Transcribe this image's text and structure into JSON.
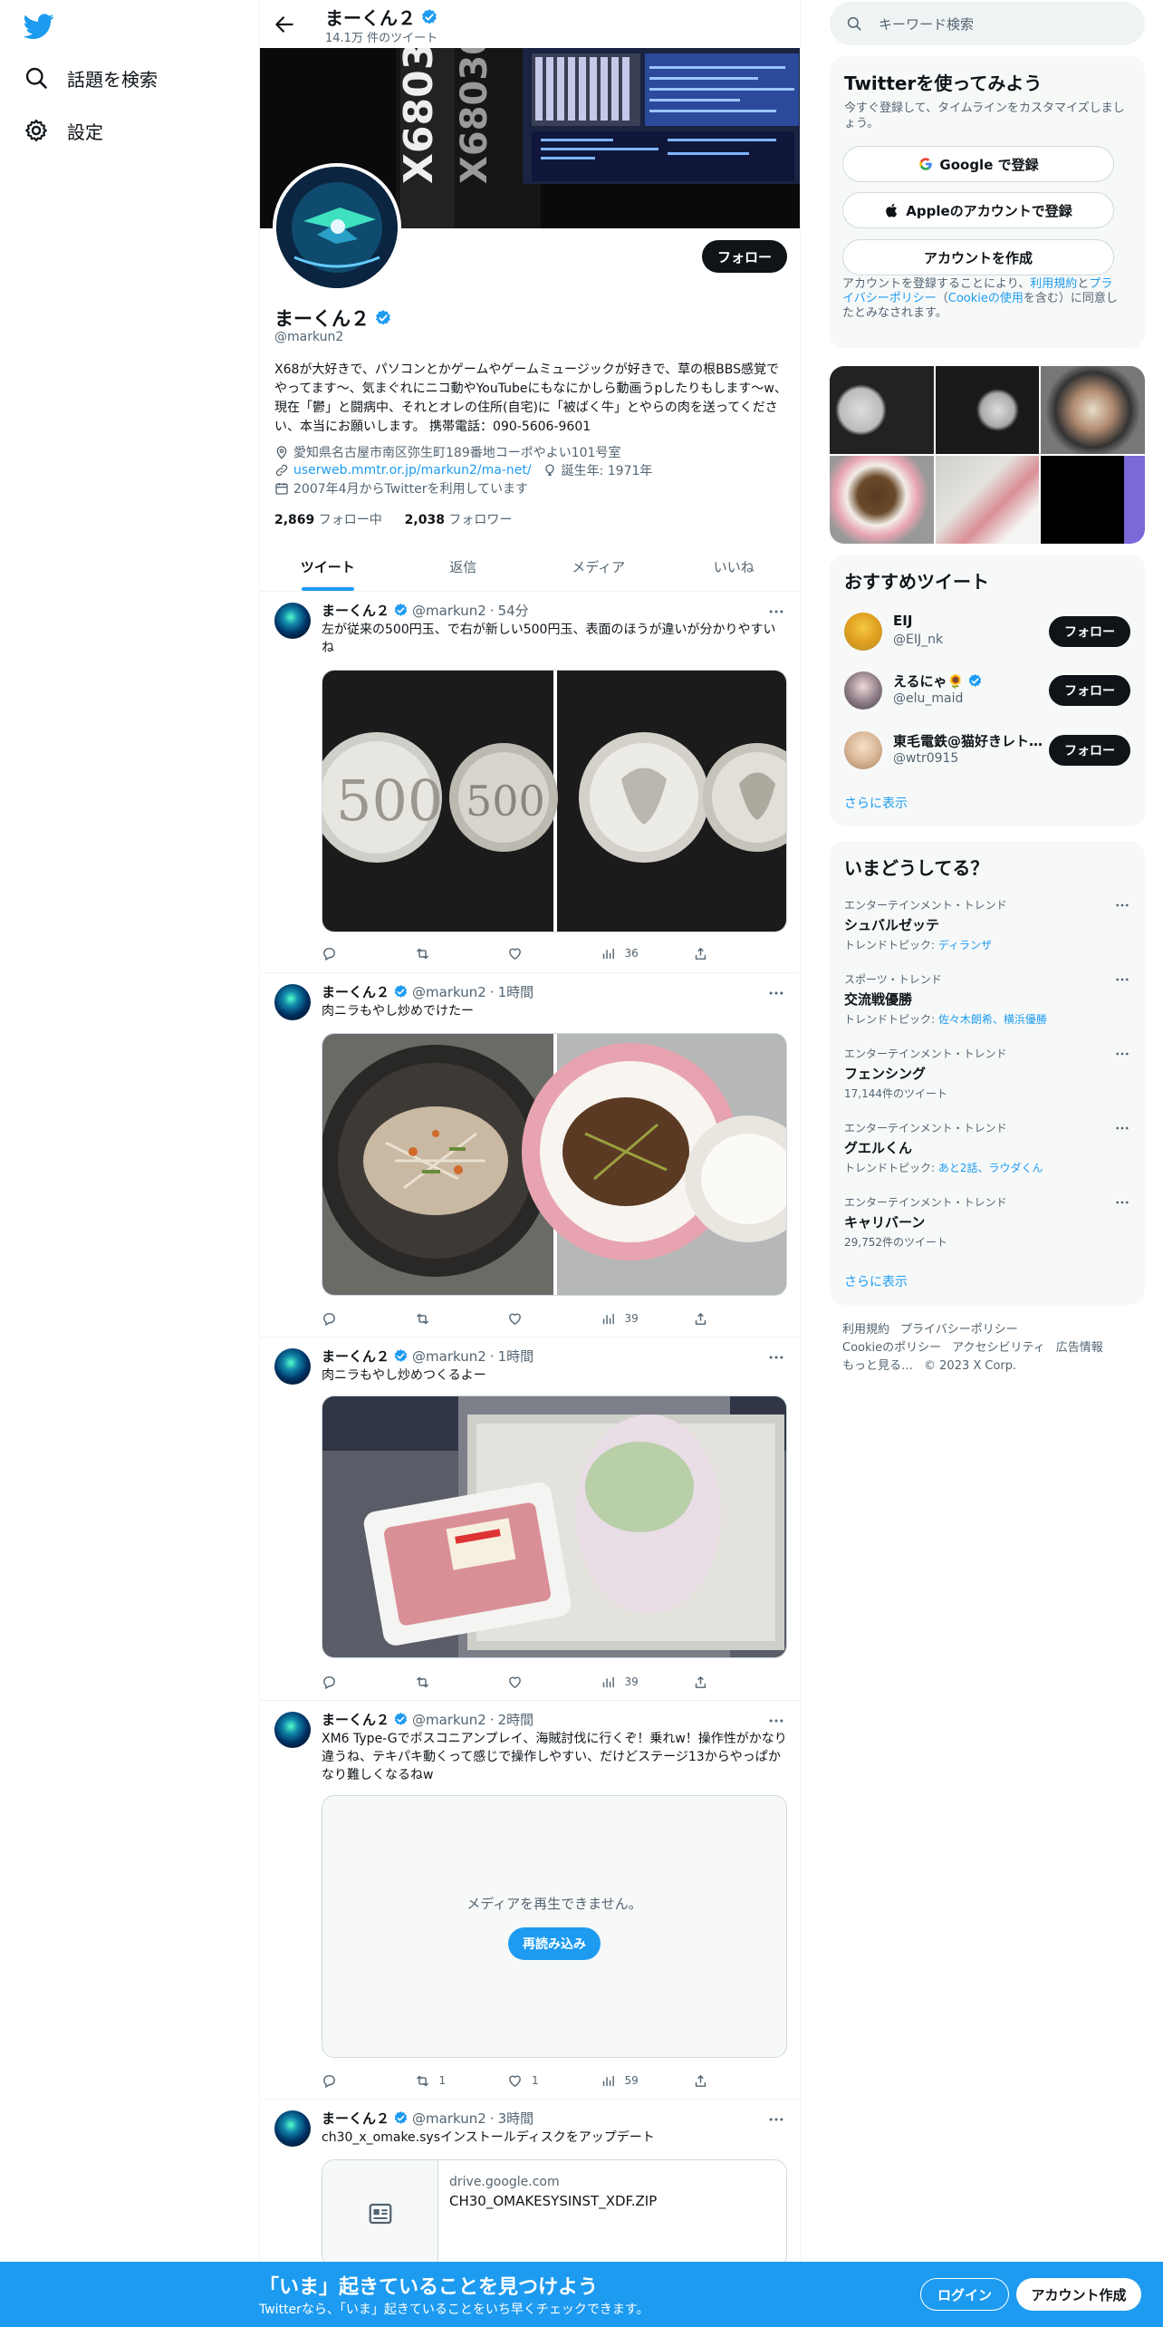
{
  "nav": {
    "logo": "twitter-bird",
    "items": [
      {
        "label": "話題を検索",
        "icon": "search-icon"
      },
      {
        "label": "設定",
        "icon": "gear-icon"
      }
    ]
  },
  "topbar": {
    "name": "まーくん２",
    "tweet_count": "14.1万 件のツイート"
  },
  "profile": {
    "name": "まーくん２",
    "handle": "@markun2",
    "follow_label": "フォロー",
    "bio": "X68が大好きで、パソコンとかゲームやゲームミュージックが好きで、草の根BBS感覚でやってます～、気まぐれにニコ動やYouTubeにもなにかしら動画うpしたりもします～w、現在「鬱」と闘病中、それとオレの住所(自宅)に「被ばく牛」とやらの肉を送ってください、本当にお願いします。 携帯電話：090-5606-9601",
    "location": "愛知県名古屋市南区弥生町189番地コーポやよい101号室",
    "url": "userweb.mmtr.or.jp/markun2/ma-net/",
    "birthday": "誕生年: 1971年",
    "joined": "2007年4月からTwitterを利用しています",
    "following_count": "2,869",
    "following_label": "フォロー中",
    "followers_count": "2,038",
    "followers_label": "フォロワー"
  },
  "tabs": [
    "ツイート",
    "返信",
    "メディア",
    "いいね"
  ],
  "tweets": [
    {
      "name": "まーくん２",
      "handle": "@markun2",
      "time": "54分",
      "text": "左が従来の500円玉、で右が新しい500円玉、表面のほうが違いが分かりやすいね",
      "reply": "",
      "retweet": "",
      "like": "",
      "views": "36"
    },
    {
      "name": "まーくん２",
      "handle": "@markun2",
      "time": "1時間",
      "text": "肉ニラもやし炒めでけたー",
      "reply": "",
      "retweet": "",
      "like": "",
      "views": "39"
    },
    {
      "name": "まーくん２",
      "handle": "@markun2",
      "time": "1時間",
      "text": "肉ニラもやし炒めつくるよー",
      "reply": "",
      "retweet": "",
      "like": "",
      "views": "39"
    },
    {
      "name": "まーくん２",
      "handle": "@markun2",
      "time": "2時間",
      "text": "XM6 Type-Gでボスコニアンプレイ、海賊討伐に行くぞ！乗れw！操作性がかなり違うね、テキパキ動くって感じで操作しやすい、だけどステージ13からやっぱかなり難しくなるねw",
      "media_error": "メディアを再生できません。",
      "reload_label": "再読み込み",
      "reply": "",
      "retweet": "1",
      "like": "1",
      "views": "59"
    },
    {
      "name": "まーくん２",
      "handle": "@markun2",
      "time": "3時間",
      "text": "ch30_x_omake.sysインストールディスクをアップデート",
      "card_domain": "drive.google.com",
      "card_title": "CH30_OMAKESYSINST_XDF.ZIP"
    }
  ],
  "right": {
    "search_placeholder": "キーワード検索",
    "signup": {
      "title": "Twitterを使ってみよう",
      "subtitle": "今すぐ登録して、タイムラインをカスタマイズしましょう。",
      "google": "Google で登録",
      "apple": "Appleのアカウントで登録",
      "create": "アカウントを作成",
      "legal_1": "アカウントを登録することにより、",
      "legal_terms": "利用規約",
      "legal_2": "と",
      "legal_privacy": "プライバシーポリシー",
      "legal_3": "（",
      "legal_cookie": "Cookieの使用",
      "legal_4": "を含む）に同意したとみなされます。"
    },
    "recommend": {
      "title": "おすすめツイート",
      "users": [
        {
          "name": "EIJ",
          "handle": "@EIJ_nk",
          "verified": false
        },
        {
          "name": "えるにゃ🌻",
          "handle": "@elu_maid",
          "verified": true
        },
        {
          "name": "東毛電鉄@猫好きレト…",
          "handle": "@wtr0915",
          "verified": false
        }
      ],
      "follow_label": "フォロー",
      "more": "さらに表示"
    },
    "trends": {
      "title": "いまどうしてる？",
      "items": [
        {
          "category": "エンターテインメント・トレンド",
          "name": "シュバルゼッテ",
          "extra_prefix": "トレンドトピック: ",
          "extra_links": "ディランザ",
          "extra_plain": ""
        },
        {
          "category": "スポーツ・トレンド",
          "name": "交流戦優勝",
          "extra_prefix": "トレンドトピック: ",
          "extra_links": "佐々木朗希、横浜優勝",
          "extra_plain": ""
        },
        {
          "category": "エンターテインメント・トレンド",
          "name": "フェンシング",
          "extra_prefix": "",
          "extra_links": "",
          "extra_plain": "17,144件のツイート"
        },
        {
          "category": "エンターテインメント・トレンド",
          "name": "グエルくん",
          "extra_prefix": "トレンドトピック: ",
          "extra_links": "あと2話、ラウダくん",
          "extra_plain": ""
        },
        {
          "category": "エンターテインメント・トレンド",
          "name": "キャリバーン",
          "extra_prefix": "",
          "extra_links": "",
          "extra_plain": "29,752件のツイート"
        }
      ],
      "more": "さらに表示"
    },
    "footer": [
      "利用規約",
      "プライバシーポリシー",
      "Cookieのポリシー",
      "アクセシビリティ",
      "広告情報",
      "もっと見る…",
      "© 2023 X Corp."
    ]
  },
  "bottombar": {
    "title": "「いま」起きていることを見つけよう",
    "subtitle": "Twitterなら、「いま」起きていることをいち早くチェックできます。",
    "login": "ログイン",
    "signup": "アカウント作成"
  },
  "colors": {
    "accent": "#1d9bf0",
    "text": "#0f1419",
    "muted": "#536471",
    "border": "#eff3f4",
    "panel": "#f7f9f9"
  }
}
